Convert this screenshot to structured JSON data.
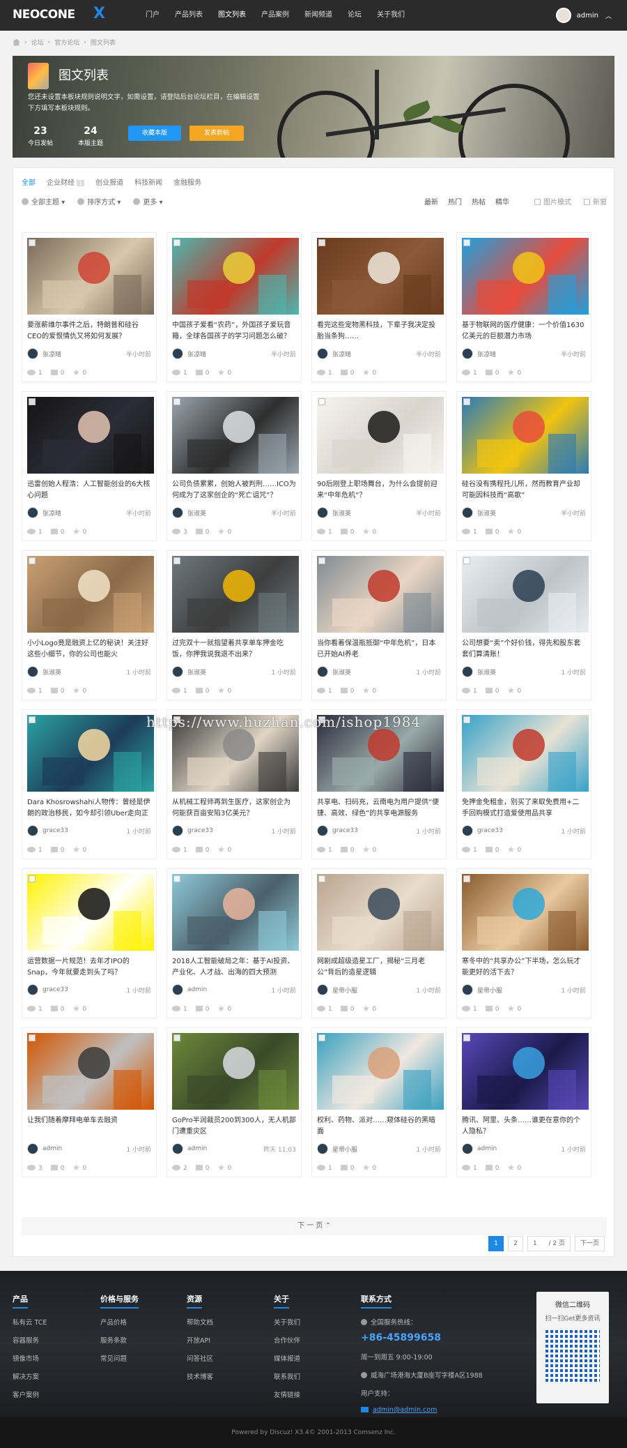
{
  "header": {
    "logo": "NEOCONE",
    "logo_x": "X",
    "nav": [
      "门户",
      "产品列表",
      "图文列表",
      "产品案例",
      "新闻频道",
      "论坛",
      "关于我们"
    ],
    "active_nav": "图文列表",
    "user": "admin"
  },
  "breadcrumb": [
    "论坛",
    "官方论坛",
    "图文列表"
  ],
  "banner": {
    "title": "图文列表",
    "desc": "您还未设置本板块规则说明文字，如需设置，请登陆后台论坛栏目，在编辑设置下方填写本板块规则。",
    "stats": [
      {
        "num": "23",
        "label": "今日发帖"
      },
      {
        "num": "24",
        "label": "本版主题"
      }
    ],
    "fav_button": "收藏本版",
    "post_button": "发表新帖"
  },
  "tabs": {
    "items": [
      "全部",
      "企业财经",
      "创业报道",
      "科技新闻",
      "金融服务"
    ],
    "badge": "1",
    "active": "全部"
  },
  "filters": {
    "left": [
      "全部主题",
      "排序方式",
      "更多"
    ],
    "sorts": [
      "最新",
      "热门",
      "热帖",
      "精华"
    ],
    "modes": [
      "图片模式",
      "新窗"
    ]
  },
  "posts": [
    {
      "title": "要涨薪维尔事件之后，特朗普和硅谷CEO的爱恨情仇又将如何发展？",
      "author": "张凉晴",
      "time": "半小时前",
      "views": "1",
      "comments": "0",
      "likes": "0",
      "colors": [
        "#7a6a5a",
        "#c43",
        "#d8c7aa"
      ]
    },
    {
      "title": "中国孩子爱看“农药”，外国孩子爱玩音箱，全球各国孩子的学习问题怎么破？",
      "author": "张凉晴",
      "time": "半小时前",
      "views": "1",
      "comments": "0",
      "likes": "0",
      "colors": [
        "#4bb8b0",
        "#e9d03a",
        "#c0392b"
      ]
    },
    {
      "title": "看完这些宠物黑科技，下辈子我决定投胎当条狗……",
      "author": "张凉晴",
      "time": "半小时前",
      "views": "1",
      "comments": "0",
      "likes": "0",
      "colors": [
        "#6b3b1f",
        "#efe8dd",
        "#8a5a38"
      ]
    },
    {
      "title": "基于物联网的医疗健康：一个价值1630亿美元的巨额潜力市场",
      "author": "张凉晴",
      "time": "半小时前",
      "views": "1",
      "comments": "0",
      "likes": "0",
      "colors": [
        "#1da1e0",
        "#f0c419",
        "#e74c3c"
      ]
    },
    {
      "title": "迅雷创始人程浩：人工智能创业的6大核心问题",
      "author": "张凉晴",
      "time": "半小时前",
      "views": "1",
      "comments": "0",
      "likes": "0",
      "colors": [
        "#151515",
        "#e3c4b0",
        "#2c2c38"
      ]
    },
    {
      "title": "公司负债累累，创始人被判刑……ICO为何成为了这家创企的“死亡诅咒”？",
      "author": "张淑英",
      "time": "半小时前",
      "views": "3",
      "comments": "0",
      "likes": "0",
      "colors": [
        "#9aa5ae",
        "#dfe2e5",
        "#2e2e2e"
      ]
    },
    {
      "title": "90后刚登上职场舞台，为什么会提前迎来“中年危机”？",
      "author": "张淑英",
      "time": "半小时前",
      "views": "1",
      "comments": "0",
      "likes": "0",
      "colors": [
        "#f6f3ee",
        "#1a1a1a",
        "#d9d4cc"
      ]
    },
    {
      "title": "硅谷没有携程托儿所，然而教育产业却可能因科技而“高歌”",
      "author": "张淑英",
      "time": "半小时前",
      "views": "1",
      "comments": "0",
      "likes": "0",
      "colors": [
        "#2a7ab8",
        "#e74c3c",
        "#f1c40f"
      ]
    },
    {
      "title": "小小Logo竟是融资上亿的秘诀！关注好这些小细节，你的公司也能火",
      "author": "张淑英",
      "time": "1 小时前",
      "views": "1",
      "comments": "0",
      "likes": "0",
      "colors": [
        "#c9a074",
        "#f3e3c6",
        "#8a6a4a"
      ]
    },
    {
      "title": "过完双十一就指望着共享单车押金吃饭，你押我说我退不出来？",
      "author": "张淑英",
      "time": "1 小时前",
      "views": "1",
      "comments": "0",
      "likes": "0",
      "colors": [
        "#6d7a80",
        "#f2b705",
        "#3d3d3d"
      ]
    },
    {
      "title": "当你看着保温瓶抵御“中年危机”，日本已开始AI养老",
      "author": "张淑英",
      "time": "1 小时前",
      "views": "1",
      "comments": "0",
      "likes": "0",
      "colors": [
        "#7f8a93",
        "#c0392b",
        "#e9d6c3"
      ]
    },
    {
      "title": "公司想要“卖”个好价钱，得先和股东套套们算清账！",
      "author": "张淑英",
      "time": "1 小时前",
      "views": "1",
      "comments": "0",
      "likes": "0",
      "colors": [
        "#e9edf1",
        "#2c3e50",
        "#bdc3c7"
      ]
    },
    {
      "title": "Dara Khosrowshahi人物传：曾经是伊朗的政治移民，如今却引领Uber走向正",
      "author": "grace33",
      "time": "1 小时前",
      "views": "1",
      "comments": "0",
      "likes": "0",
      "colors": [
        "#2ba3a3",
        "#f7d9a0",
        "#1d3c5a"
      ]
    },
    {
      "title": "从机械工程师再到生医疗，这家创企为何能获百亩安陷3亿美元？",
      "author": "grace33",
      "time": "1 小时前",
      "views": "1",
      "comments": "0",
      "likes": "0",
      "colors": [
        "#3b3b3b",
        "#8a8a8a",
        "#e0d5c5"
      ]
    },
    {
      "title": "共享电、扫码充，云南电为用户提供“便捷、高效、绿色”的共享电源服务",
      "author": "grace33",
      "time": "1 小时前",
      "views": "1",
      "comments": "0",
      "likes": "0",
      "colors": [
        "#2b2b3a",
        "#c0392b",
        "#9aa"
      ]
    },
    {
      "title": "免押金免租金，别买了来取免费用+二手回购模式打造爱使用品共享",
      "author": "grace33",
      "time": "1 小时前",
      "views": "1",
      "comments": "0",
      "likes": "0",
      "colors": [
        "#35a2c9",
        "#c0392b",
        "#e8e2d4"
      ]
    },
    {
      "title": "运营数据一片规范！去年才IPO的Snap，今年就要走到头了吗？",
      "author": "grace33",
      "time": "1 小时前",
      "views": "1",
      "comments": "0",
      "likes": "0",
      "colors": [
        "#fff200",
        "#111111",
        "#ffffff"
      ]
    },
    {
      "title": "2018人工智能破局之年：基于AI投资、产业化、人才战、出海的四大预测",
      "author": "admin",
      "time": "1 小时前",
      "views": "1",
      "comments": "0",
      "likes": "0",
      "colors": [
        "#8fc9d8",
        "#e9b59b",
        "#4a5f6a"
      ]
    },
    {
      "title": "网剧成超级造星工厂，揭秘“三月老公”背后的造星逻辑",
      "author": "星帝小服",
      "time": "1 小时前",
      "views": "1",
      "comments": "0",
      "likes": "0",
      "colors": [
        "#b9a590",
        "#3a4a5a",
        "#e8dccb"
      ]
    },
    {
      "title": "寒冬中的“共享办公”下半场，怎么玩才能更好的活下去？",
      "author": "星帝小服",
      "time": "1 小时前",
      "views": "1",
      "comments": "0",
      "likes": "0",
      "colors": [
        "#8a5a2e",
        "#2ea8d8",
        "#e8c9a0"
      ]
    },
    {
      "title": "让我们随着摩拜电单车去融资",
      "author": "admin",
      "time": "1 小时前",
      "views": "3",
      "comments": "0",
      "likes": "0",
      "colors": [
        "#d35400",
        "#3a3a3a",
        "#c0c0c0"
      ]
    },
    {
      "title": "GoPro半润裁员200到300人，无人机部门遭重灾区",
      "author": "admin",
      "time": "昨天 11:03",
      "views": "2",
      "comments": "0",
      "likes": "0",
      "colors": [
        "#6d8a3a",
        "#d8dce0",
        "#3a4a2a"
      ]
    },
    {
      "title": "权利、药物、派对……窥体硅谷的黑暗面",
      "author": "星帝小服",
      "time": "1 小时前",
      "views": "1",
      "comments": "0",
      "likes": "0",
      "colors": [
        "#3aa0c0",
        "#d8a07a",
        "#f0e8e0"
      ]
    },
    {
      "title": "腾讯、阿里、头条……谁更在意你的个人隐私？",
      "author": "admin",
      "time": "1 小时前",
      "views": "1",
      "comments": "0",
      "likes": "0",
      "colors": [
        "#5a48b8",
        "#3aa0e0",
        "#1a1a4a"
      ]
    }
  ],
  "more": "下 一 页",
  "watermark": "https://www.huzhan.com/ishop1984",
  "pager": {
    "pages": [
      "1",
      "2"
    ],
    "current": "1",
    "input": "1",
    "total": "/ 2 页",
    "next": "下一页"
  },
  "footer": {
    "cols": [
      {
        "title": "产品",
        "links": [
          "私有云 TCE",
          "容器服务",
          "镜像市场",
          "解决方案",
          "客户案例"
        ]
      },
      {
        "title": "价格与服务",
        "links": [
          "产品价格",
          "服务条款",
          "常见问题"
        ]
      },
      {
        "title": "资源",
        "links": [
          "帮助文档",
          "开放API",
          "问答社区",
          "技术博客"
        ]
      },
      {
        "title": "关于",
        "links": [
          "关于我们",
          "合作伙伴",
          "媒体报道",
          "联系我们",
          "友情链接"
        ]
      }
    ],
    "contact_title": "联系方式",
    "hotline_label": "全国服务热线：",
    "phone": "+86-45899658",
    "hours": "周一到周五 9:00-19:00",
    "address": "威海广场港海大厦B座写字楼A区1988",
    "support_label": "用户支持：",
    "email": "admin@admin.com",
    "qr_title": "微信二维码",
    "qr_sub": "扫一扫Get更多资讯"
  },
  "copyright": "Powered by Discuz! X3.4© 2001-2013 Comsenz Inc."
}
